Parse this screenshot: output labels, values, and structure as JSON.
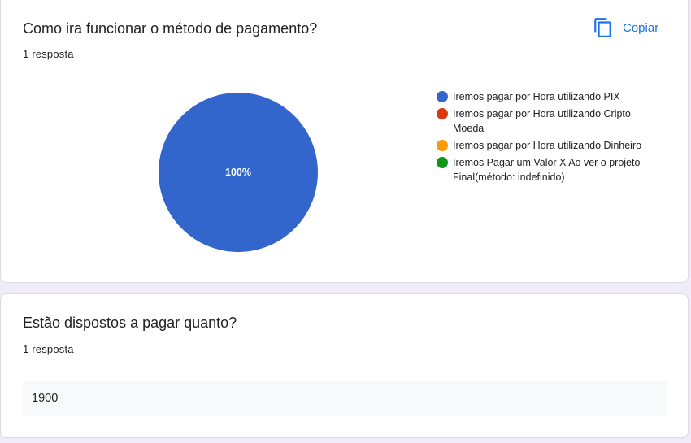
{
  "question1": {
    "title": "Como ira funcionar o método de pagamento?",
    "count": "1 resposta",
    "copy_label": "Copiar",
    "copy_icon": "copy-icon"
  },
  "chart_data": {
    "type": "pie",
    "slices": [
      {
        "label": "Iremos pagar por Hora utilizando PIX",
        "value": 100,
        "color": "#3366cc"
      },
      {
        "label": "Iremos pagar por Hora utilizando Cripto Moeda",
        "value": 0,
        "color": "#dc3912"
      },
      {
        "label": "Iremos pagar por Hora utilizando Dinheiro",
        "value": 0,
        "color": "#ff9900"
      },
      {
        "label": "Iremos Pagar um Valor X Ao ver o projeto Final(método: indefinido)",
        "value": 0,
        "color": "#109618"
      }
    ],
    "data_label": "100%",
    "legend_position": "right"
  },
  "question2": {
    "title": "Estão dispostos a pagar quanto?",
    "count": "1 resposta",
    "answer": "1900"
  }
}
